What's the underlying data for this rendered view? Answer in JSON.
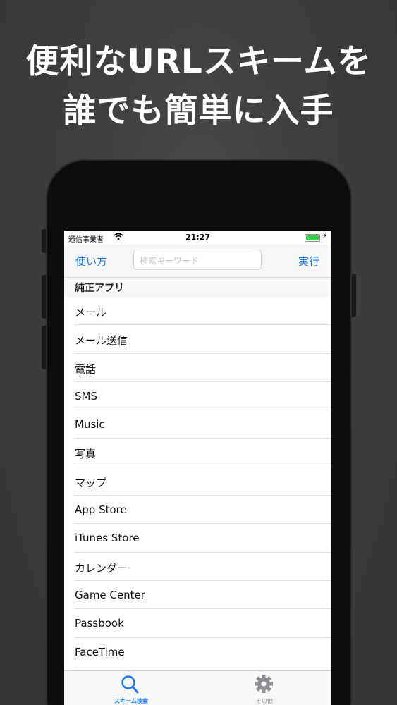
{
  "promo": {
    "line1": "便利なURLスキームを",
    "line2": "誰でも簡単に入手"
  },
  "status_bar": {
    "carrier": "通信事業者",
    "time": "21:27"
  },
  "navbar": {
    "left_button": "使い方",
    "search_placeholder": "検索キーワード",
    "right_button": "実行"
  },
  "section": {
    "title": "純正アプリ"
  },
  "items": [
    "メール",
    "メール送信",
    "電話",
    "SMS",
    "Music",
    "写真",
    "マップ",
    "App Store",
    "iTunes Store",
    "カレンダー",
    "Game Center",
    "Passbook",
    "FaceTime"
  ],
  "tabbar": {
    "tabs": [
      {
        "label": "スキーム検索",
        "icon": "search-icon",
        "selected": true
      },
      {
        "label": "その他",
        "icon": "gear-icon",
        "selected": false
      }
    ]
  },
  "colors": {
    "accent": "#1a7af8",
    "background": "#3c3c3e"
  }
}
